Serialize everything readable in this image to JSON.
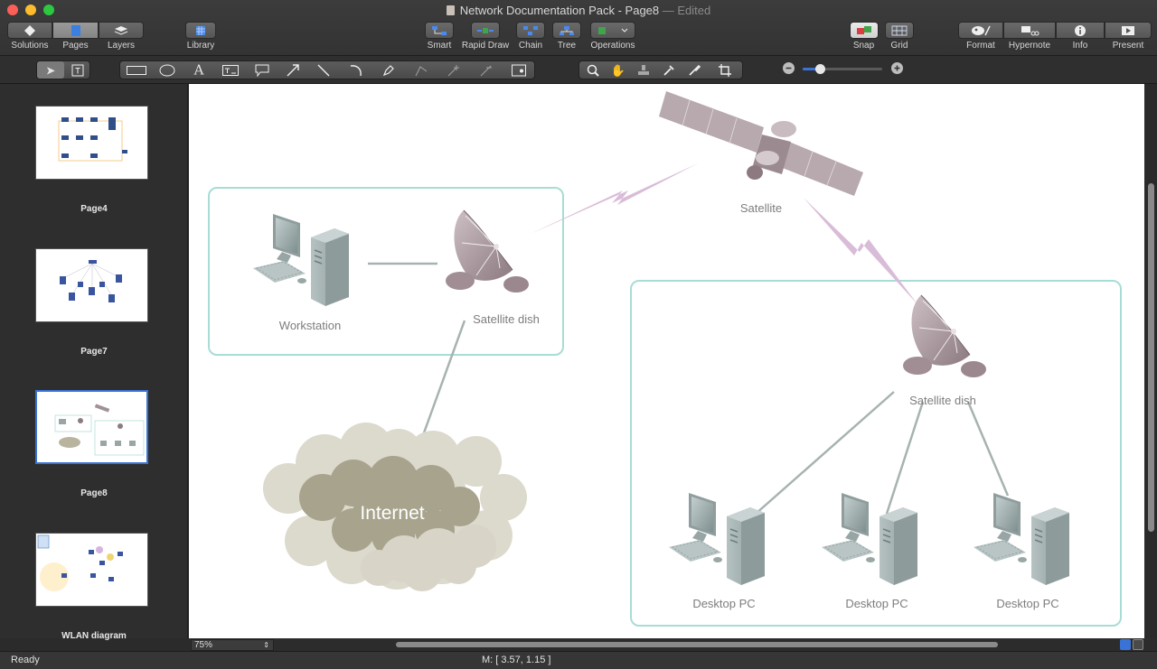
{
  "window": {
    "title": "Network Documentation Pack - Page8",
    "edited": "— Edited"
  },
  "toolbar": {
    "solutions": "Solutions",
    "pages": "Pages",
    "layers": "Layers",
    "library": "Library",
    "smart": "Smart",
    "rapid_draw": "Rapid Draw",
    "chain": "Chain",
    "tree": "Tree",
    "operations": "Operations",
    "snap": "Snap",
    "grid": "Grid",
    "format": "Format",
    "hypernote": "Hypernote",
    "info": "Info",
    "present": "Present"
  },
  "pages": [
    {
      "label": "Page4"
    },
    {
      "label": "Page7"
    },
    {
      "label": "Page8"
    },
    {
      "label": "WLAN diagram"
    }
  ],
  "diagram": {
    "satellite": "Satellite",
    "satellite_dish_1": "Satellite dish",
    "satellite_dish_2": "Satellite dish",
    "workstation": "Workstation",
    "internet": "Internet",
    "desktop_1": "Desktop PC",
    "desktop_2": "Desktop PC",
    "desktop_3": "Desktop PC"
  },
  "zoom": "75%",
  "status": {
    "ready": "Ready",
    "mouse": "M: [ 3.57, 1.15 ]"
  },
  "colors": {
    "accent": "#3a73d6",
    "group_border": "#a8dcd6",
    "lightning": "#d8b8d8",
    "cloud_light": "#dad7cc",
    "cloud_dark": "#a5a18a"
  }
}
